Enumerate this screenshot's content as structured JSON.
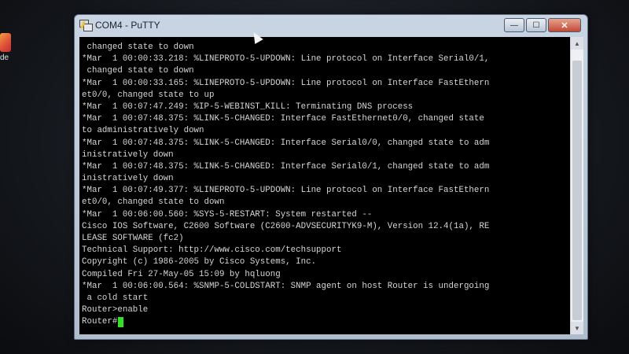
{
  "desktop": {
    "icon_label": "de"
  },
  "window": {
    "title": "COM4 - PuTTY",
    "controls": {
      "minimize": "—",
      "maximize": "☐",
      "close": "✕"
    }
  },
  "terminal": {
    "lines": [
      " changed state to down",
      "*Mar  1 00:00:33.218: %LINEPROTO-5-UPDOWN: Line protocol on Interface Serial0/1,",
      " changed state to down",
      "*Mar  1 00:00:33.165: %LINEPROTO-5-UPDOWN: Line protocol on Interface FastEthern",
      "et0/0, changed state to up",
      "*Mar  1 00:07:47.249: %IP-5-WEBINST_KILL: Terminating DNS process",
      "*Mar  1 00:07:48.375: %LINK-5-CHANGED: Interface FastEthernet0/0, changed state",
      "to administratively down",
      "*Mar  1 00:07:48.375: %LINK-5-CHANGED: Interface Serial0/0, changed state to adm",
      "inistratively down",
      "*Mar  1 00:07:48.375: %LINK-5-CHANGED: Interface Serial0/1, changed state to adm",
      "inistratively down",
      "*Mar  1 00:07:49.377: %LINEPROTO-5-UPDOWN: Line protocol on Interface FastEthern",
      "et0/0, changed state to down",
      "*Mar  1 00:06:00.560: %SYS-5-RESTART: System restarted --",
      "Cisco IOS Software, C2600 Software (C2600-ADVSECURITYK9-M), Version 12.4(1a), RE",
      "LEASE SOFTWARE (fc2)",
      "Technical Support: http://www.cisco.com/techsupport",
      "Copyright (c) 1986-2005 by Cisco Systems, Inc.",
      "Compiled Fri 27-May-05 15:09 by hqluong",
      "*Mar  1 00:06:00.564: %SNMP-5-COLDSTART: SNMP agent on host Router is undergoing",
      " a cold start",
      "Router>enable"
    ],
    "prompt": "Router#",
    "cursor_color": "#2fe31f",
    "text_color": "#d6d6d6"
  }
}
